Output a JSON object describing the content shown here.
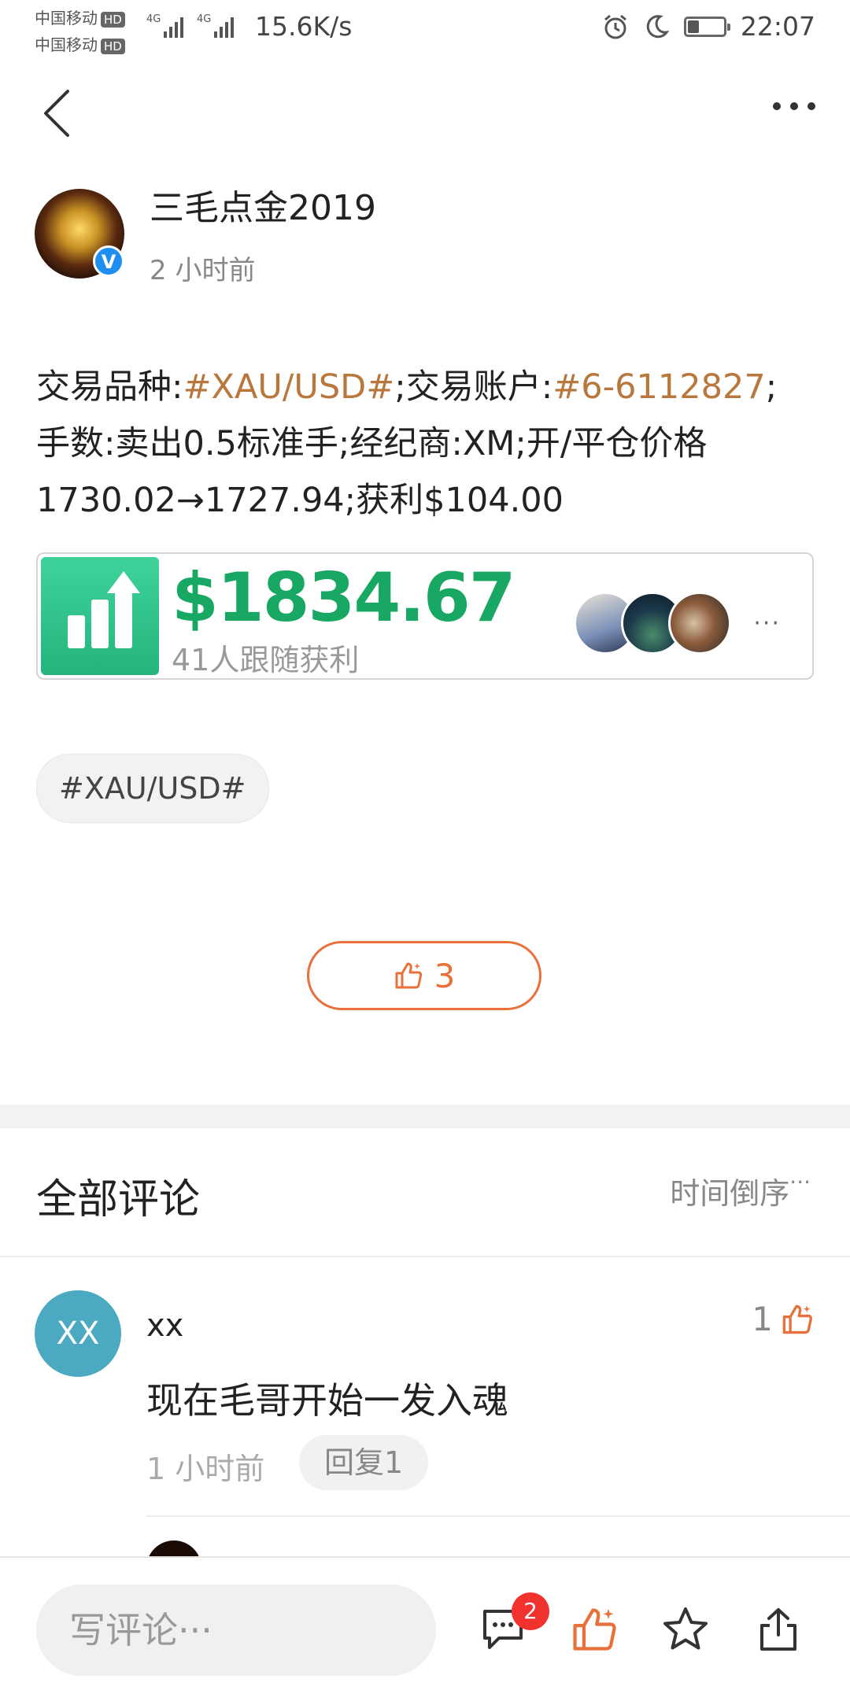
{
  "status_bar": {
    "carrier1": "中国移动",
    "carrier2": "中国移动",
    "hd": "HD",
    "net": "4G",
    "speed": "15.6K/s",
    "time": "22:07",
    "battery_level": 0.3
  },
  "post": {
    "author": "三毛点金2019",
    "time": "2 小时前",
    "text_parts": {
      "p1": "交易品种:",
      "tag1": "#XAU/USD#",
      "p2": ";交易账户:",
      "tag2": "#6-6112827",
      "p3": ";",
      "line2": "手数:卖出0.5标准手;经纪商:XM;开/平仓价格",
      "line3": "1730.02→1727.94;获利$104.00"
    },
    "card": {
      "amount": "$1834.67",
      "subtitle": "41人跟随获利",
      "more": "···"
    },
    "topic_chip": "#XAU/USD#",
    "likes": "3"
  },
  "comments": {
    "title": "全部评论",
    "sort": "时间倒序",
    "sort_icon": "···",
    "items": [
      {
        "avatar": "XX",
        "name": "xx",
        "likes": "1",
        "text": "现在毛哥开始一发入魂",
        "time": "1 小时前",
        "reply": "回复1"
      }
    ]
  },
  "bottom_bar": {
    "input_placeholder": "写评论···",
    "comment_badge": "2"
  },
  "colors": {
    "accent_orange": "#e8713b",
    "tag_brown": "#b8773c",
    "profit_green": "#18a863",
    "badge_red": "#f2322f"
  }
}
